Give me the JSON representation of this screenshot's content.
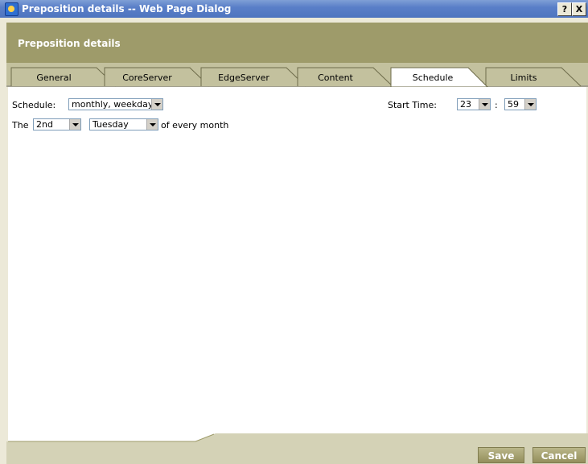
{
  "window": {
    "title": "Preposition details -- Web Page Dialog",
    "help_label": "?",
    "close_label": "X"
  },
  "header": {
    "title": "Preposition details"
  },
  "tabs": [
    {
      "label": "General",
      "active": false
    },
    {
      "label": "CoreServer",
      "active": false
    },
    {
      "label": "EdgeServer",
      "active": false
    },
    {
      "label": "Content",
      "active": false
    },
    {
      "label": "Schedule",
      "active": true
    },
    {
      "label": "Limits",
      "active": false
    }
  ],
  "schedule": {
    "schedule_label": "Schedule:",
    "schedule_value": "monthly, weekday",
    "the_label": "The",
    "ordinal_value": "2nd",
    "weekday_value": "Tuesday",
    "suffix_text": "of every month",
    "start_time_label": "Start Time:",
    "hour_value": "23",
    "time_separator": ":",
    "minute_value": "59"
  },
  "footer": {
    "save_label": "Save",
    "cancel_label": "Cancel"
  }
}
